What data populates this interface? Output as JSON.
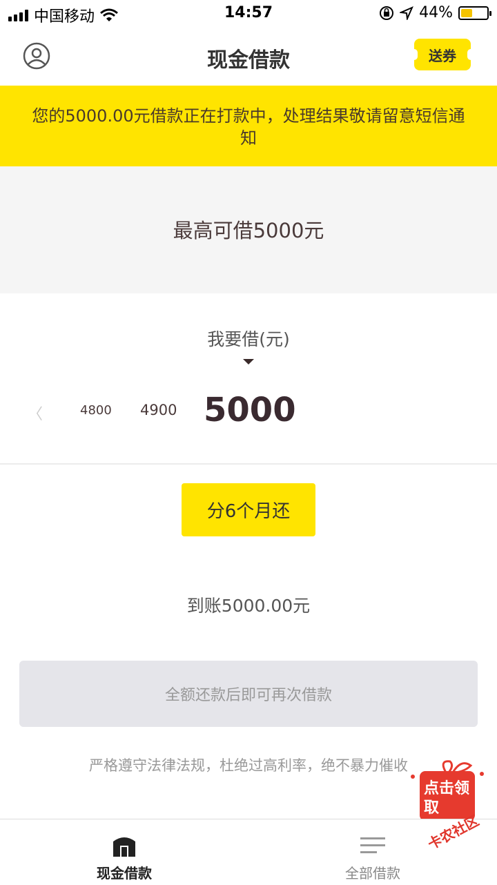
{
  "status_bar": {
    "carrier": "中国移动",
    "time": "14:57",
    "battery": "44%",
    "battery_level": 0.44,
    "icons": [
      "signal-icon",
      "wifi-icon",
      "orientation-lock-icon",
      "location-icon",
      "battery-icon"
    ]
  },
  "nav": {
    "title": "现金借款",
    "coupon_label": "送券",
    "left_icon": "user-profile-icon"
  },
  "notice": {
    "text": "您的5000.00元借款正在打款中，处理结果敬请留意短信通知"
  },
  "limit": {
    "text": "最高可借5000元"
  },
  "amount_picker": {
    "label": "我要借(元)",
    "options": [
      "4800",
      "4900",
      "5000"
    ],
    "selected": "5000"
  },
  "term": {
    "label": "分6个月还"
  },
  "received": {
    "text": "到账5000.00元"
  },
  "main_button": {
    "label": "全额还款后即可再次借款"
  },
  "disclaimer": "严格遵守法律法规，杜绝过高利率，绝不暴力催收",
  "promo": {
    "text": "点击领取"
  },
  "tabbar": {
    "items": [
      {
        "label": "现金借款",
        "icon": "home-icon",
        "active": true
      },
      {
        "label": "全部借款",
        "icon": "list-icon",
        "active": false
      }
    ]
  },
  "watermark": "卡农社区",
  "colors": {
    "accent": "#ffe400",
    "panel": "#f5f5f5",
    "disabled_button": "#e5e5ea",
    "promo_red": "#e63a2e"
  }
}
